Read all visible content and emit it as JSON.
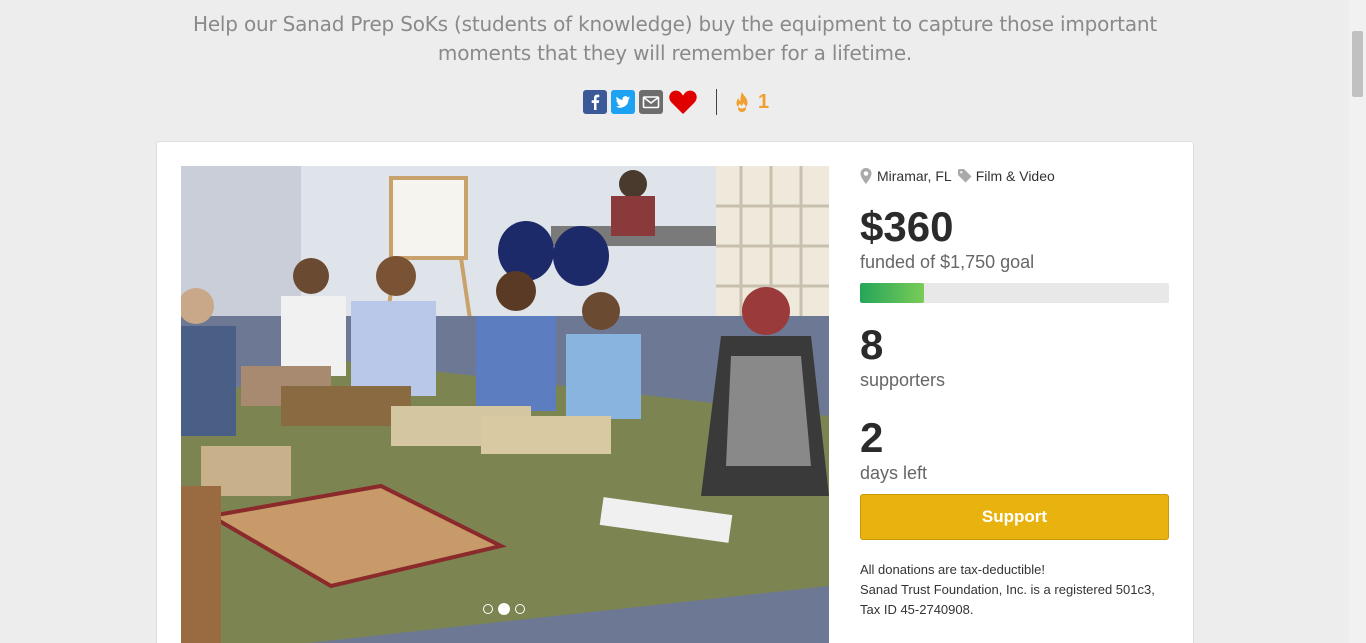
{
  "tagline": "Help our Sanad Prep SoKs (students of knowledge) buy the equipment to capture those important moments that they will remember for a lifetime.",
  "share": {
    "facebook_icon": "facebook-icon",
    "twitter_icon": "twitter-icon",
    "email_icon": "email-icon",
    "heart_icon": "heart-icon",
    "fire_count": "1"
  },
  "campaign": {
    "location": "Miramar, FL",
    "category": "Film & Video",
    "amount": "$360",
    "goal_text": "funded of $1,750 goal",
    "progress_fraction": 0.206,
    "supporters_count": "8",
    "supporters_label": "supporters",
    "days_count": "2",
    "days_label": "days left",
    "support_button": "Support",
    "tax_note_1": "All donations are tax-deductible!",
    "tax_note_2": "Sanad Trust Foundation, Inc. is a registered 501c3, Tax ID 45-2740908."
  },
  "carousel": {
    "slides": 3,
    "active_index": 1
  },
  "colors": {
    "accent": "#e8b30f",
    "progress_start": "#25a55a",
    "progress_end": "#79cc56",
    "fire": "#f0a030",
    "heart": "#e00000"
  }
}
